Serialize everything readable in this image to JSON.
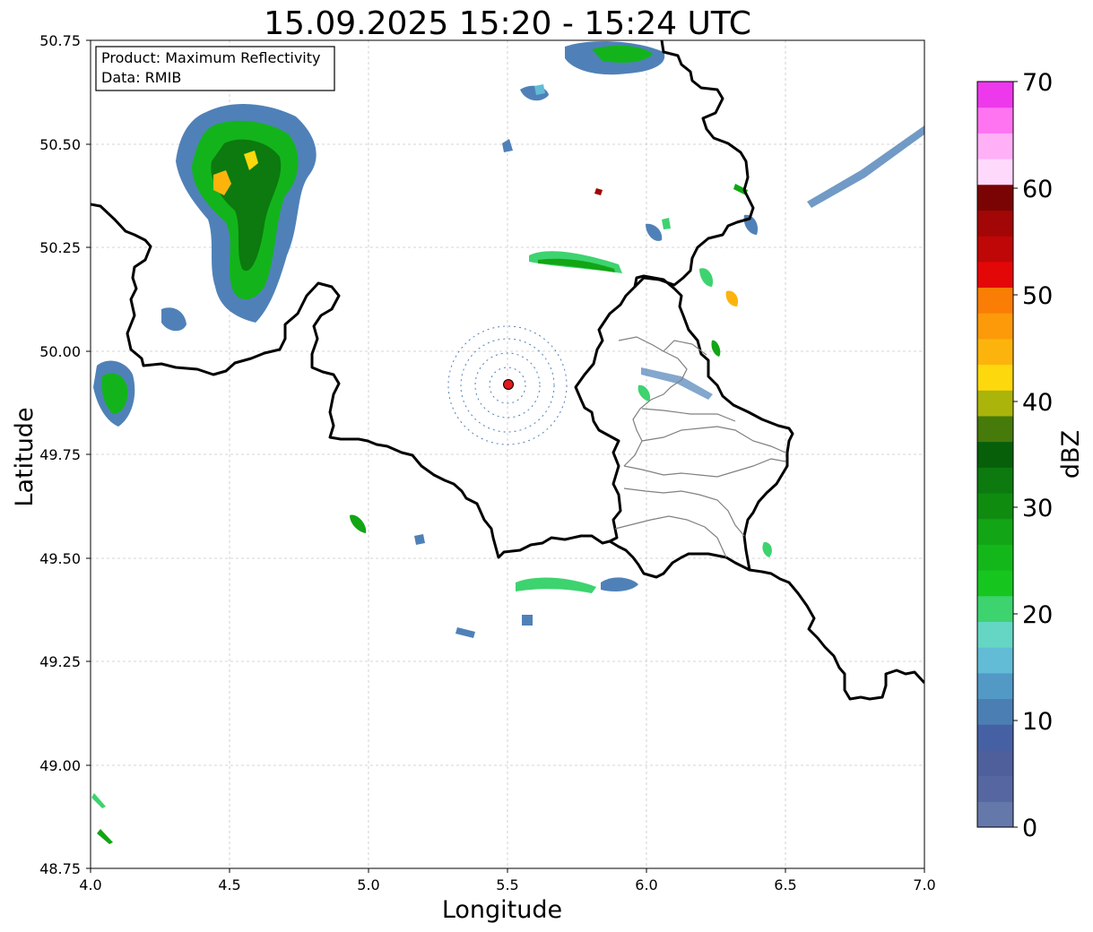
{
  "title": "15.09.2025 15:20 - 15:24 UTC",
  "info_box": {
    "line1": "Product: Maximum Reflectivity",
    "line2": "Data: RMIB"
  },
  "xlabel": "Longitude",
  "ylabel": "Latitude",
  "x_ticks": [
    "4.0",
    "4.5",
    "5.0",
    "5.5",
    "6.0",
    "6.5",
    "7.0"
  ],
  "y_ticks": [
    "50.75",
    "50.50",
    "50.25",
    "50.00",
    "49.75",
    "49.50",
    "49.25",
    "49.00",
    "48.75"
  ],
  "colorbar": {
    "label": "dBZ",
    "ticks": [
      "0",
      "10",
      "20",
      "30",
      "40",
      "50",
      "60",
      "70"
    ],
    "colors": [
      "#6578aa",
      "#5666a0",
      "#4e5f9c",
      "#4660a4",
      "#4b7eb3",
      "#5299c6",
      "#62bcd6",
      "#65d6c4",
      "#3dd36f",
      "#16c61f",
      "#14b71a",
      "#12a515",
      "#0f8c10",
      "#0c7a0e",
      "#075f0a",
      "#467a0a",
      "#aab40a",
      "#fcd80d",
      "#fcb40d",
      "#fc9a0a",
      "#fa7d06",
      "#e40708",
      "#bf0707",
      "#a20606",
      "#7a0404",
      "#ffd9fc",
      "#ffb0f7",
      "#ff74f1",
      "#ee38ec"
    ]
  },
  "radar_site": {
    "lon": 5.505,
    "lat": 49.914,
    "color": "#e3191c"
  },
  "map_extent": {
    "lon": [
      4.0,
      7.0
    ],
    "lat": [
      48.75,
      50.75
    ]
  },
  "colors": {
    "border": "#000000",
    "district": "#808080",
    "grid": "#c8c8c8"
  }
}
